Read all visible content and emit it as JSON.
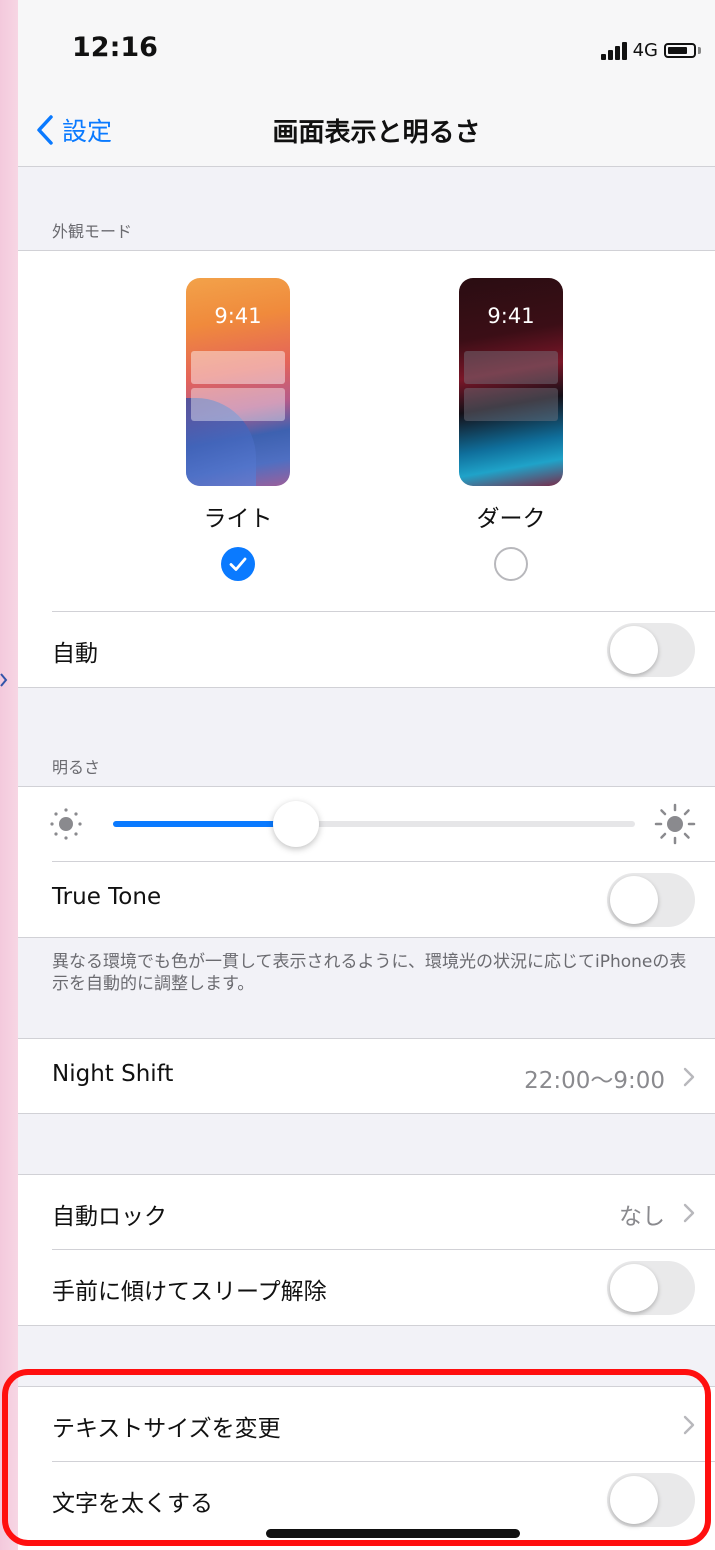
{
  "status": {
    "time": "12:16",
    "network": "4G"
  },
  "nav": {
    "back_label": "設定",
    "title": "画面表示と明るさ"
  },
  "appearance": {
    "header": "外観モード",
    "light": {
      "label": "ライト",
      "time": "9:41",
      "selected": true
    },
    "dark": {
      "label": "ダーク",
      "time": "9:41",
      "selected": false
    },
    "auto": {
      "label": "自動",
      "on": false
    }
  },
  "brightness": {
    "header": "明るさ",
    "level_percent": 35,
    "true_tone": {
      "label": "True Tone",
      "on": false
    },
    "footnote": "異なる環境でも色が一貫して表示されるように、環境光の状況に応じてiPhoneの表示を自動的に調整します。"
  },
  "night_shift": {
    "label": "Night Shift",
    "value": "22:00〜9:00"
  },
  "lock": {
    "auto_lock": {
      "label": "自動ロック",
      "value": "なし"
    },
    "raise_to_wake": {
      "label": "手前に傾けてスリープ解除",
      "on": false
    }
  },
  "text": {
    "text_size": {
      "label": "テキストサイズを変更"
    },
    "bold_text": {
      "label": "文字を太くする",
      "on": false
    }
  },
  "colors": {
    "accent": "#0a7aff",
    "highlight": "#ff0f0f",
    "toggle_off": "#e9e9ea"
  }
}
